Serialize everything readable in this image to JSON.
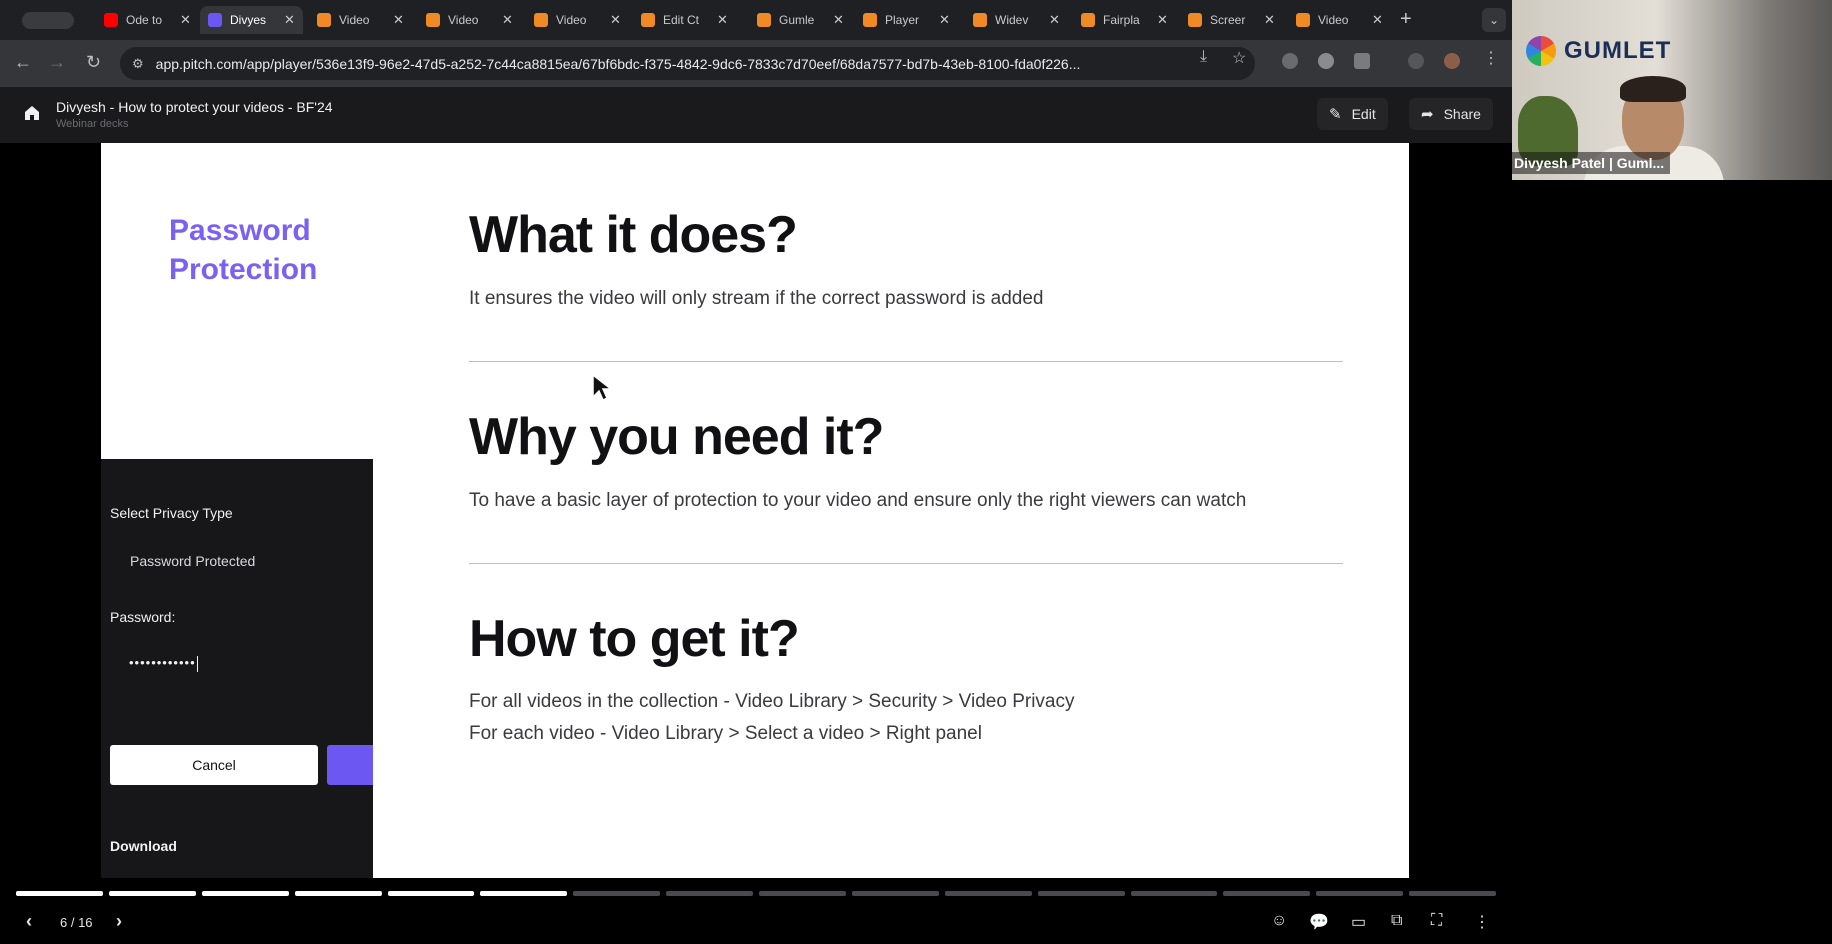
{
  "browser": {
    "tabs": [
      {
        "title": "Ode to",
        "favicon_color": "#ff0000"
      },
      {
        "title": "Divyes",
        "favicon_color": "#6c57f3",
        "active": true
      },
      {
        "title": "Video",
        "favicon_color": "#f08a24"
      },
      {
        "title": "Video",
        "favicon_color": "#f08a24"
      },
      {
        "title": "Video",
        "favicon_color": "#f08a24"
      },
      {
        "title": "Edit Ct",
        "favicon_color": "#f08a24"
      },
      {
        "title": "Gumle",
        "favicon_color": "#f08a24"
      },
      {
        "title": "Player",
        "favicon_color": "#f08a24"
      },
      {
        "title": "Widev",
        "favicon_color": "#f08a24"
      },
      {
        "title": "Fairpla",
        "favicon_color": "#f08a24"
      },
      {
        "title": "Screer",
        "favicon_color": "#f08a24"
      },
      {
        "title": "Video",
        "favicon_color": "#f08a24"
      }
    ],
    "close_glyph": "✕",
    "new_tab_glyph": "+",
    "tab_menu_glyph": "⌄",
    "back_glyph": "←",
    "forward_glyph": "→",
    "reload_glyph": "↻",
    "url": "app.pitch.com/app/player/536e13f9-96e2-47d5-a252-7c44ca8815ea/67bf6bdc-f375-4842-9dc6-7833c7d70eef/68da7577-bd7b-43eb-8100-fda0f226...",
    "tune_glyph": "⚙",
    "install_glyph": "⤓",
    "bookmark_glyph": "☆",
    "menu_glyph": "⋮"
  },
  "pitch": {
    "title": "Divyesh - How to protect your videos - BF'24",
    "subtitle": "Webinar decks",
    "edit_label": "Edit",
    "share_label": "Share",
    "edit_glyph": "✎",
    "share_glyph": "➦"
  },
  "slide": {
    "title": "Password Protection",
    "sections": [
      {
        "heading": "What it does?",
        "lines": [
          "It ensures the video will only stream if the correct password is added"
        ]
      },
      {
        "heading": "Why you need it?",
        "lines": [
          "To have a basic layer of protection to your video and ensure only the right viewers can watch"
        ]
      },
      {
        "heading": "How to get it?",
        "lines": [
          "For all videos in the collection - Video Library > Security > Video Privacy",
          "For each video - Video Library > Select a video > Right panel"
        ]
      }
    ],
    "panel": {
      "privacy_label": "Select Privacy Type",
      "privacy_value": "Password Protected",
      "password_label": "Password:",
      "password_value": "••••••••••••",
      "cancel_label": "Cancel",
      "download_label": "Download"
    }
  },
  "player": {
    "current": 6,
    "total": 16,
    "counter": "6 / 16",
    "prev_glyph": "‹",
    "next_glyph": "›",
    "controls": [
      "☺",
      "💬",
      "▭",
      "⧉",
      "⛶",
      "⋮"
    ]
  },
  "video": {
    "brand": "GUMLET",
    "caption": "Divyesh Patel | Guml..."
  },
  "colors": {
    "accent": "#7b61f2",
    "progress_done": "#ffffff",
    "progress_todo": "#4a4a4e"
  }
}
